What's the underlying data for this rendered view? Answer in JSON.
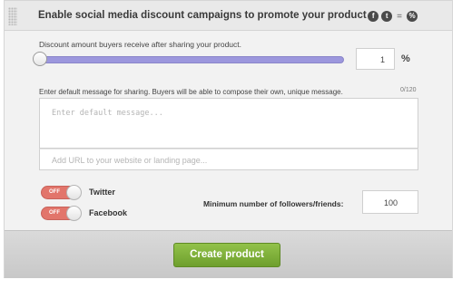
{
  "section": {
    "title": "Enable social media discount campaigns to promote your product",
    "icons": [
      "facebook-icon",
      "twitter-icon",
      "equals-icon",
      "discount-icon"
    ]
  },
  "discount": {
    "label": "Discount amount buyers receive after sharing your product.",
    "value": "1",
    "slider_fraction": 0.01,
    "unit": "%"
  },
  "message": {
    "label": "Enter default message for sharing. Buyers will be able to compose their own, unique message.",
    "counter": "0/120",
    "placeholder": "Enter default message...",
    "url_placeholder": "Add URL to your website or landing page..."
  },
  "networks": [
    {
      "name": "Twitter",
      "state": "OFF"
    },
    {
      "name": "Facebook",
      "state": "OFF"
    }
  ],
  "followers": {
    "label": "Minimum number of followers/friends:",
    "value": "100"
  },
  "footer": {
    "create_button": "Create product"
  },
  "colors": {
    "slider": "#9c97dd",
    "toggle_off": "#e2756b",
    "create_button": "#7fb23b"
  }
}
